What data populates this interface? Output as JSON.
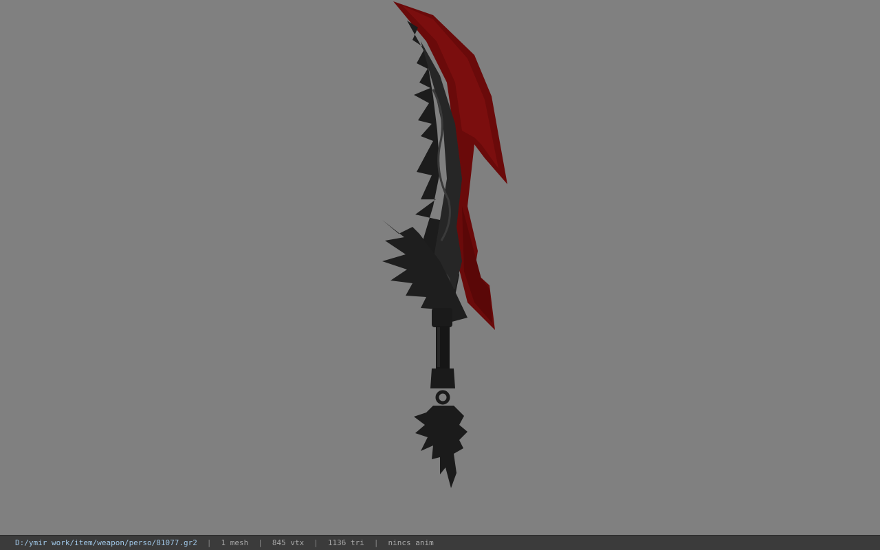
{
  "viewer": {
    "background_color": "#808080",
    "model_icon": "sword-model"
  },
  "status": {
    "file_path": "D:/ymir work/item/weapon/perso/81077.gr2",
    "separator": "|",
    "mesh": "1 mesh",
    "vtx": "845 vtx",
    "tri": "1136 tri",
    "anim": "nincs anim"
  }
}
